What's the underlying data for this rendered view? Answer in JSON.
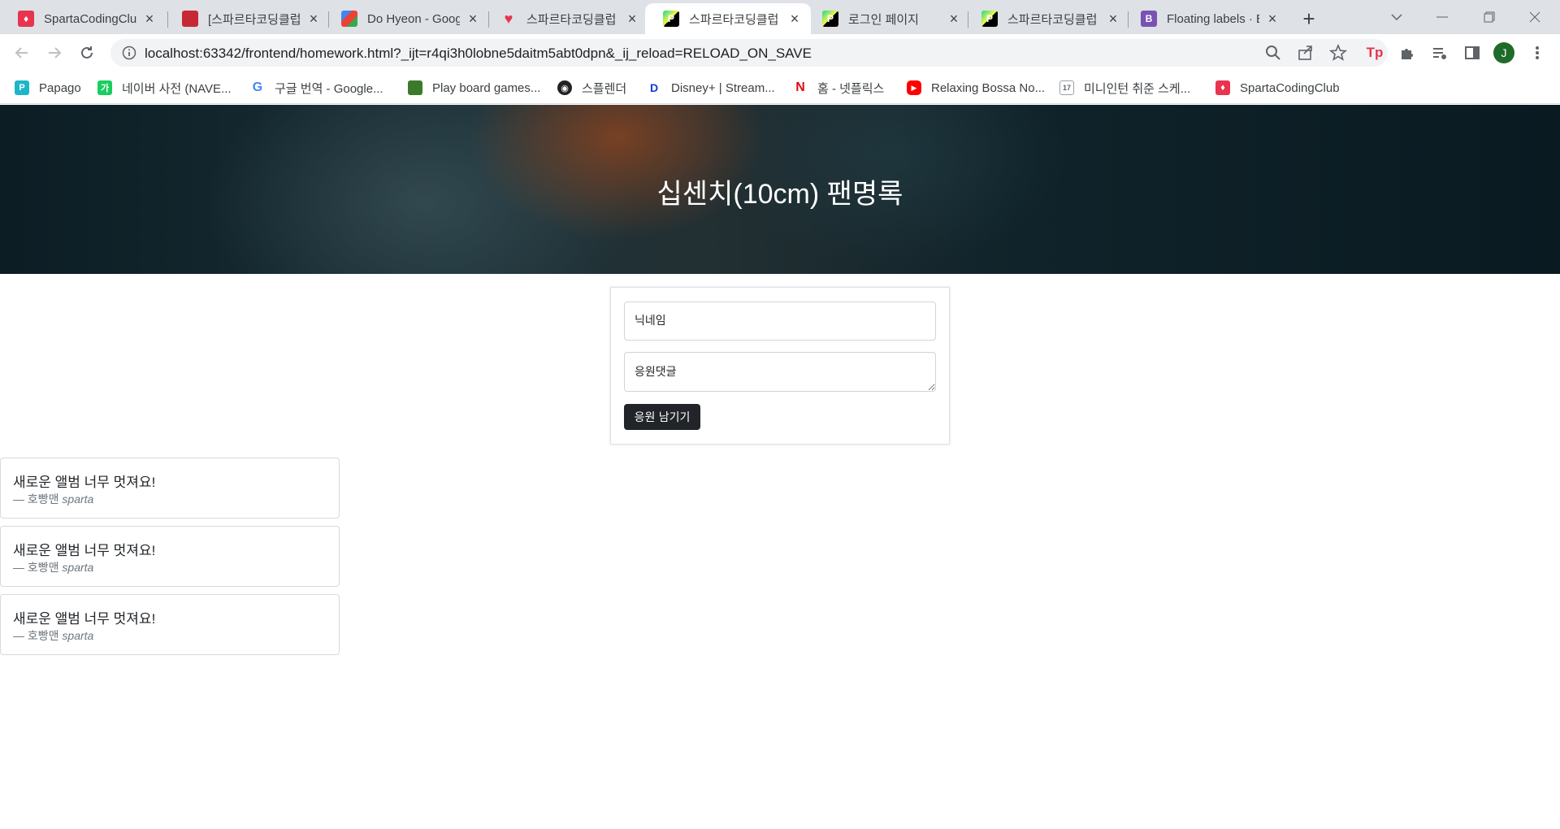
{
  "browser": {
    "tabs": [
      {
        "title": "SpartaCodingClub",
        "favicon": "sparta-icon",
        "active": false
      },
      {
        "title": "[스파르타코딩클럽]",
        "favicon": "book-icon",
        "active": false
      },
      {
        "title": "Do Hyeon - Google Fonts",
        "favicon": "google-fonts-icon",
        "active": false
      },
      {
        "title": "스파르타코딩클럽",
        "favicon": "heart-icon",
        "active": false
      },
      {
        "title": "스파르타코딩클럽",
        "favicon": "pycharm-icon",
        "active": true
      },
      {
        "title": "로그인 페이지",
        "favicon": "pycharm-icon",
        "active": false
      },
      {
        "title": "스파르타코딩클럽",
        "favicon": "pycharm-icon",
        "active": false
      },
      {
        "title": "Floating labels · Bootstrap",
        "favicon": "bootstrap-icon",
        "active": false
      }
    ],
    "url": "localhost:63342/frontend/homework.html?_ijt=r4qi3h0lobne5daitm5abt0dpn&_ij_reload=RELOAD_ON_SAVE",
    "avatar_letter": "J",
    "bookmarks": [
      {
        "label": "Papago",
        "icon": "papago-icon",
        "color": "#1fb5c9"
      },
      {
        "label": "네이버 사전 (NAVE...",
        "icon": "naver-dict-icon",
        "color": "#19ce60"
      },
      {
        "label": "구글 번역 - Google...",
        "icon": "google-icon",
        "color": "#ffffff"
      },
      {
        "label": "Play board games...",
        "icon": "boardgame-icon",
        "color": "#3b7a2a"
      },
      {
        "label": "스플렌더",
        "icon": "splendor-icon",
        "color": "#222222"
      },
      {
        "label": "Disney+ | Stream...",
        "icon": "disney-icon",
        "color": "#ffffff"
      },
      {
        "label": "홈 - 넷플릭스",
        "icon": "netflix-icon",
        "color": "#e50914"
      },
      {
        "label": "Relaxing Bossa No...",
        "icon": "youtube-icon",
        "color": "#ff0000"
      },
      {
        "label": "미니인턴 취준 스케...",
        "icon": "calendar-icon",
        "color": "#ffffff"
      },
      {
        "label": "SpartaCodingClub",
        "icon": "sparta-icon",
        "color": "#e8344e"
      }
    ]
  },
  "page": {
    "title": "십센치(10cm) 팬명록",
    "form": {
      "nickname_placeholder": "닉네임",
      "comment_placeholder": "응원댓글",
      "submit_label": "응원 남기기"
    },
    "comments": [
      {
        "text": "새로운 앨범 너무 멋져요!",
        "author": "— 호빵맨 ",
        "source": "sparta"
      },
      {
        "text": "새로운 앨범 너무 멋져요!",
        "author": "— 호빵맨 ",
        "source": "sparta"
      },
      {
        "text": "새로운 앨범 너무 멋져요!",
        "author": "— 호빵맨 ",
        "source": "sparta"
      }
    ]
  },
  "colors": {
    "tab_strip": "#dee1e6",
    "button_dark": "#212529",
    "accent_red": "#e8344e"
  }
}
